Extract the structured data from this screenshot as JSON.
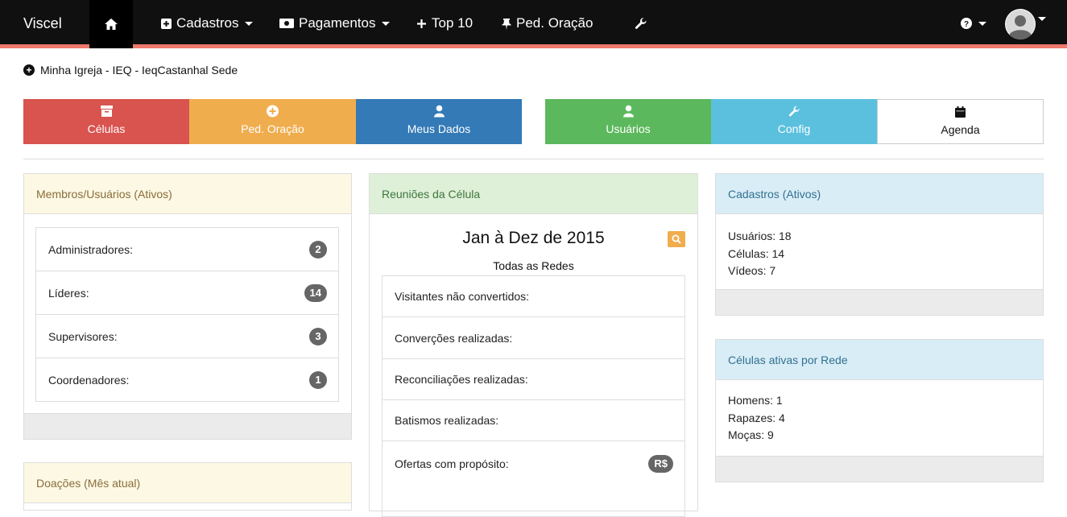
{
  "navbar": {
    "brand": "Viscel",
    "items": [
      {
        "label": "Cadastros",
        "icon": "plus-square-icon"
      },
      {
        "label": "Pagamentos",
        "icon": "money-icon"
      },
      {
        "label": "Top 10",
        "icon": "plus-icon"
      },
      {
        "label": "Ped. Oração",
        "icon": "pin-icon"
      }
    ],
    "tools_icon": "wrench-icon",
    "help_icon": "question-circle-icon",
    "avatar_icon": "user-avatar-icon",
    "accent_color": "#f0776c"
  },
  "breadcrumb": {
    "text": "Minha Igreja - IEQ - IeqCastanhal Sede"
  },
  "tiles": [
    {
      "label": "Células",
      "icon": "archive-icon",
      "color": "#d9534f"
    },
    {
      "label": "Ped. Oração",
      "icon": "plus-circle-icon",
      "color": "#f0ad4e"
    },
    {
      "label": "Meus Dados",
      "icon": "user-icon",
      "color": "#337ab7"
    },
    {
      "label": "Usuários",
      "icon": "user-icon",
      "color": "#5cb85c"
    },
    {
      "label": "Config",
      "icon": "wrench-icon",
      "color": "#5bc0de"
    },
    {
      "label": "Agenda",
      "icon": "calendar-icon",
      "color": "#ffffff"
    }
  ],
  "membros": {
    "title": "Membros/Usuários (Ativos)",
    "rows": [
      {
        "label": "Administradores:",
        "count": "2"
      },
      {
        "label": "Líderes:",
        "count": "14"
      },
      {
        "label": "Supervisores:",
        "count": "3"
      },
      {
        "label": "Coordenadores:",
        "count": "1"
      }
    ]
  },
  "doacoes": {
    "title": "Doações (Mês atual)"
  },
  "reunioes": {
    "title": "Reuniões da Célula",
    "period": "Jan à Dez de 2015",
    "subtitle": "Todas as Redes",
    "rows": [
      {
        "label": "Visitantes não convertidos:",
        "badge": ""
      },
      {
        "label": "Converções realizadas:",
        "badge": ""
      },
      {
        "label": "Reconciliações realizadas:",
        "badge": ""
      },
      {
        "label": "Batismos realizadas:",
        "badge": ""
      },
      {
        "label": "Ofertas com propósito:",
        "badge": "R$"
      }
    ]
  },
  "cadastros": {
    "title": "Cadastros (Ativos)",
    "lines": [
      "Usuários: 18",
      "Células: 14",
      "Vídeos: 7"
    ]
  },
  "celulas_rede": {
    "title": "Células ativas por Rede",
    "lines": [
      "Homens: 1",
      "Rapazes: 4",
      "Moças: 9"
    ]
  }
}
